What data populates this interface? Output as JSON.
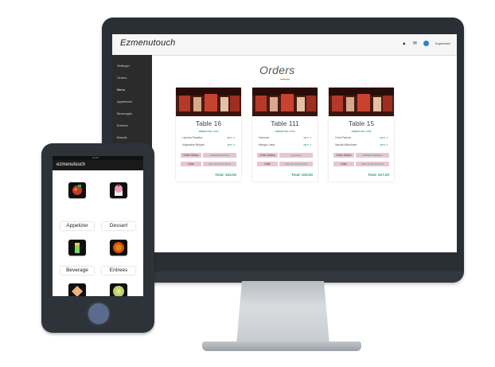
{
  "desktop": {
    "brand": "Ezmenutouch",
    "user": "Supervisor",
    "sidebar": [
      "Settings+",
      "Orders",
      "Menu",
      "Appetizers",
      "Beverages",
      "Entrees",
      "Breads"
    ],
    "page_title": "Orders",
    "orders": [
      {
        "table": "Table 16",
        "order_no": "ORDER NO: #170",
        "items": [
          {
            "name": "Laccha Paratha",
            "qty": "QTY: 1"
          },
          {
            "name": "Vegetable Biryani",
            "qty": "QTY: 1"
          }
        ],
        "status_label": "Order Status",
        "status_value": "ORDER PENDING",
        "date_label": "Date",
        "date_value": "2017-10-26 16:10:02",
        "total": "Total: $15.00"
      },
      {
        "table": "Table 111",
        "order_no": "ORDER NO: #175",
        "items": [
          {
            "name": "Samosa",
            "qty": "QTY: 1"
          },
          {
            "name": "Mango Lassi",
            "qty": "QTY: 1"
          }
        ],
        "status_label": "Order Status",
        "status_value": "Approved",
        "date_label": "Date",
        "date_value": "2017-10-25 20:03:53",
        "total": "Total: $15.00"
      },
      {
        "table": "Table 15",
        "order_no": "ORDER NO: #178",
        "items": [
          {
            "name": "Gobi Pakora",
            "qty": "QTY: 1"
          },
          {
            "name": "Vanilla Milkshake",
            "qty": "QTY: 1"
          }
        ],
        "status_label": "Order Status",
        "status_value": "ORDER PENDING",
        "date_label": "Date",
        "date_value": "2017-10-25 15:14:15",
        "total": "Total: $17.00"
      }
    ]
  },
  "phone": {
    "status_time": "10:40",
    "app_title": "ezmenutouch",
    "categories": [
      "Appetizer",
      "Dessert",
      "Beverage",
      "Entrees"
    ]
  },
  "colors": {
    "accent_green": "#2aa17a",
    "underline_orange": "#e67e22",
    "sidebar_bg": "#2b2b2b",
    "status_pink": "#e8c6ce"
  }
}
